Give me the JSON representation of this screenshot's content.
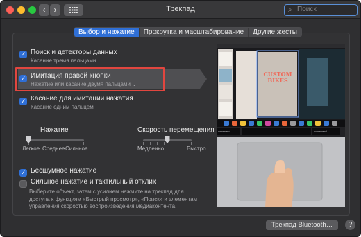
{
  "window": {
    "title": "Трекпад",
    "back_icon": "chevron-left-icon",
    "forward_icon": "chevron-right-icon",
    "grid_icon": "grid-icon"
  },
  "search": {
    "placeholder": "Поиск"
  },
  "tabs": [
    {
      "label": "Выбор и нажатие",
      "active": true
    },
    {
      "label": "Прокрутка и масштабирование",
      "active": false
    },
    {
      "label": "Другие жесты",
      "active": false
    }
  ],
  "options": {
    "lookup": {
      "label": "Поиск и детекторы данных",
      "sub": "Касание тремя пальцами",
      "checked": true
    },
    "secondary_click": {
      "label": "Имитация правой кнопки",
      "sub": "Нажатие или касание двумя пальцами",
      "checked": true
    },
    "tap_to_click": {
      "label": "Касание для имитации нажатия",
      "sub": "Касание одним пальцем",
      "checked": true
    }
  },
  "click_slider": {
    "label": "Нажатие",
    "min_label": "Легкое",
    "mid_label": "Среднее",
    "max_label": "Сильное",
    "value": 0
  },
  "speed_slider": {
    "label": "Скорость перемещения",
    "min_label": "Медленно",
    "max_label": "Быстро",
    "value": 0.5
  },
  "silent_click": {
    "label": "Бесшумное нажатие",
    "checked": true
  },
  "force_click": {
    "label": "Сильное нажатие и тактильный отклик",
    "checked": false,
    "description": "Выберите объект, затем с усилием нажмите на трекпад для доступа к функциям «Быстрый просмотр», «Поиск» и элементам управления скоростью воспроизведения медиаконтента."
  },
  "preview": {
    "poster_line1": "CUSTOM",
    "poster_line2": "BIKES",
    "key_left": "command",
    "key_right": "command"
  },
  "bluetooth_button": {
    "label": "Трекпад Bluetooth…"
  },
  "help_button": {
    "label": "?"
  },
  "colors": {
    "accent": "#2f6fd6",
    "highlight": "#e1463f",
    "window": "#2f2f31"
  }
}
